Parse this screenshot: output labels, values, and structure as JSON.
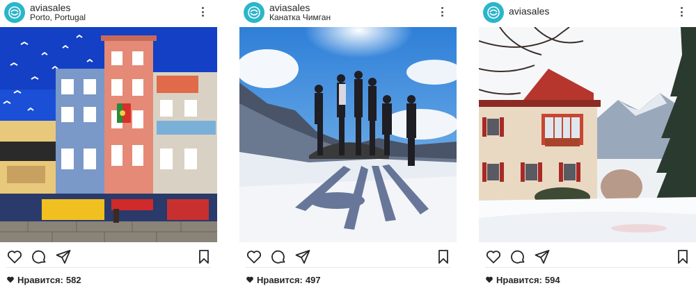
{
  "posts": [
    {
      "username": "aviasales",
      "location": "Porto, Portugal",
      "likes_label": "Нравится:",
      "likes_count": "582",
      "photo_subject": "colorful Porto houses with Portuguese flag and seagulls"
    },
    {
      "username": "aviasales",
      "location": "Канатка Чимган",
      "likes_label": "Нравится:",
      "likes_count": "497",
      "photo_subject": "group of people standing on a rock on a snowy mountain"
    },
    {
      "username": "aviasales",
      "location": "",
      "likes_label": "Нравится:",
      "likes_count": "594",
      "photo_subject": "red-trimmed chalet in snowy mountains"
    }
  ],
  "icons": {
    "avatar": "aviasales-logo-icon",
    "more": "more-options-icon",
    "like": "heart-icon",
    "comment": "comment-icon",
    "share": "share-icon",
    "save": "bookmark-icon",
    "likes": "heart-filled-icon"
  },
  "colors": {
    "brand": "#2bb5c9",
    "text": "#262626",
    "sky_porto": "#1a4fd6",
    "sky_mountain": "#3d8fe0"
  }
}
